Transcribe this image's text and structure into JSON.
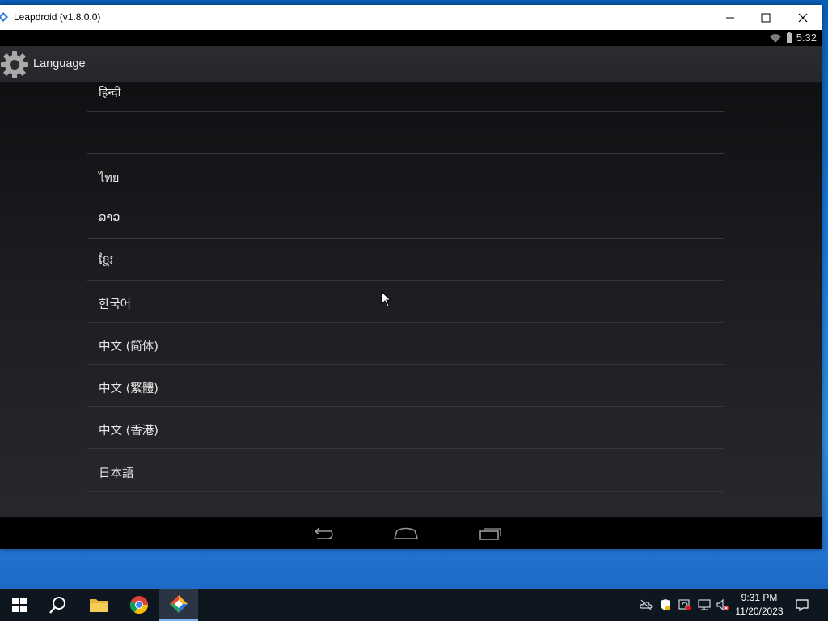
{
  "window": {
    "title": "Leapdroid (v1.8.0.0)"
  },
  "android": {
    "status_time": "5:32",
    "action_bar_title": "Language",
    "languages": [
      "हिन्दी",
      "",
      "ไทย",
      "ລາວ",
      "ខ្មែរ",
      "한국어",
      "中文 (简体)",
      "中文 (繁體)",
      "中文 (香港)",
      "日本語"
    ]
  },
  "taskbar": {
    "time": "9:31 PM",
    "date": "11/20/2023"
  },
  "colors": {
    "accent": "#7ab3f0",
    "list_divider": "#34363a"
  }
}
